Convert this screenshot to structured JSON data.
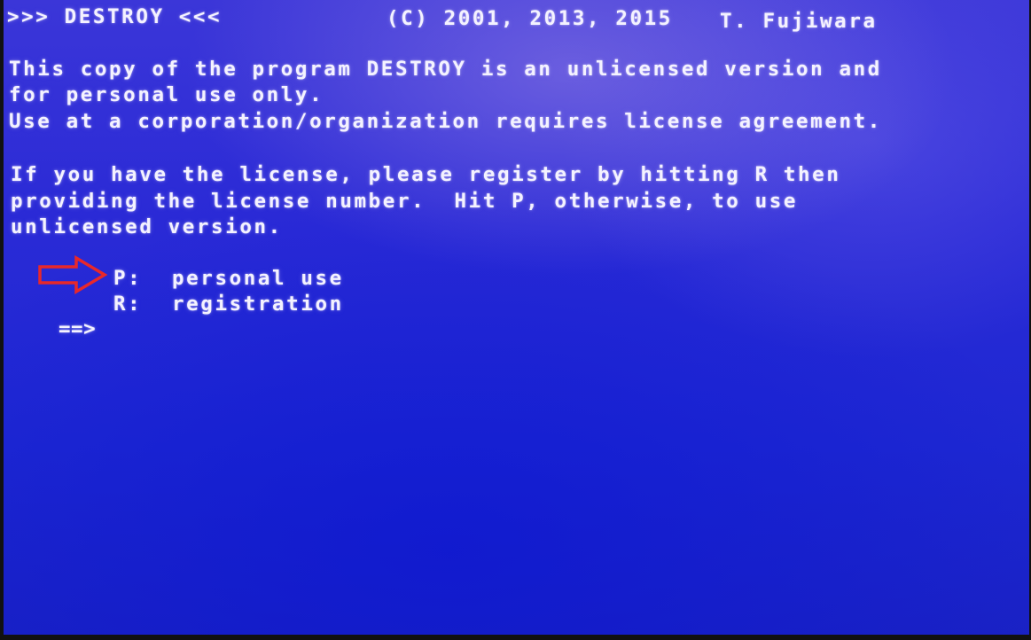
{
  "header": {
    "title": ">>> DESTROY <<<",
    "copyright": "(C) 2001, 2013, 2015",
    "author": "T. Fujiwara"
  },
  "notice": {
    "line1": "This copy of the program DESTROY is an unlicensed version and",
    "line2": "for personal use only.",
    "line3": "Use at a corporation/organization requires license agreement."
  },
  "instructions": {
    "line1": "If you have the license, please register by hitting R then",
    "line2": "providing the license number.  Hit P, otherwise, to use",
    "line3": "unlicensed version."
  },
  "options": [
    {
      "key": "P:",
      "label": "personal use"
    },
    {
      "key": "R:",
      "label": "registration"
    }
  ],
  "prompt": "==>",
  "colors": {
    "screen_background": "#2a2ad6",
    "text": "#f4f2ff",
    "annotation_arrow": "#e8282a"
  },
  "annotation": {
    "icon": "red-arrow-right-icon",
    "points_to": "P: personal use"
  }
}
